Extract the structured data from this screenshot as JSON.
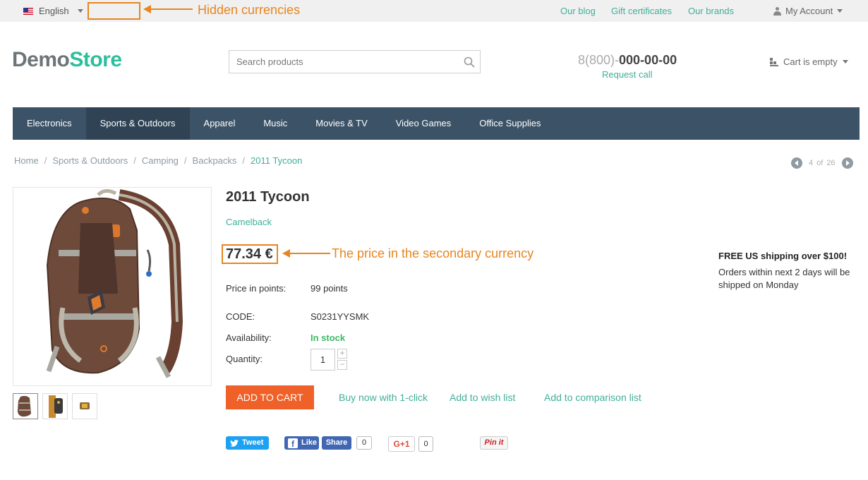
{
  "topbar": {
    "language": "English",
    "links": [
      "Our blog",
      "Gift certificates",
      "Our brands"
    ],
    "account": "My Account"
  },
  "annotations": {
    "currencies": "Hidden currencies",
    "price": "The price in the secondary currency"
  },
  "header": {
    "logo_first": "Demo",
    "logo_second": "Store",
    "search_placeholder": "Search products",
    "phone_prefix": "8(800)-",
    "phone_number": "000-00-00",
    "request_call": "Request call",
    "cart": "Cart is empty"
  },
  "nav": [
    "Electronics",
    "Sports & Outdoors",
    "Apparel",
    "Music",
    "Movies & TV",
    "Video Games",
    "Office Supplies"
  ],
  "nav_active": "Sports & Outdoors",
  "breadcrumb": [
    "Home",
    "Sports & Outdoors",
    "Camping",
    "Backpacks",
    "2011 Tycoon"
  ],
  "pager": {
    "current": "4",
    "of": "of",
    "total": "26"
  },
  "product": {
    "title": "2011 Tycoon",
    "brand": "Camelback",
    "price": "77.34 €",
    "points_label": "Price in points:",
    "points_value": "99 points",
    "code_label": "CODE:",
    "code_value": "S0231YYSMK",
    "availability_label": "Availability:",
    "availability_value": "In stock",
    "quantity_label": "Quantity:",
    "quantity_value": "1"
  },
  "actions": {
    "add_to_cart": "ADD TO CART",
    "buy_now": "Buy now with 1-click",
    "wish_list": "Add to wish list",
    "comparison": "Add to comparison list"
  },
  "shipping": {
    "title": "FREE US shipping over $100!",
    "text": "Orders within next 2 days will be shipped on Monday"
  },
  "social": {
    "tweet": "Tweet",
    "like": "Like",
    "share": "Share",
    "share_count": "0",
    "gplus": "+1",
    "gplus_count": "0",
    "pinit": "Pin it"
  },
  "colors": {
    "accent_green": "#3faf9a",
    "nav_bg": "#3c5367",
    "cart_button": "#ef6128",
    "annotation": "#e8851f"
  }
}
